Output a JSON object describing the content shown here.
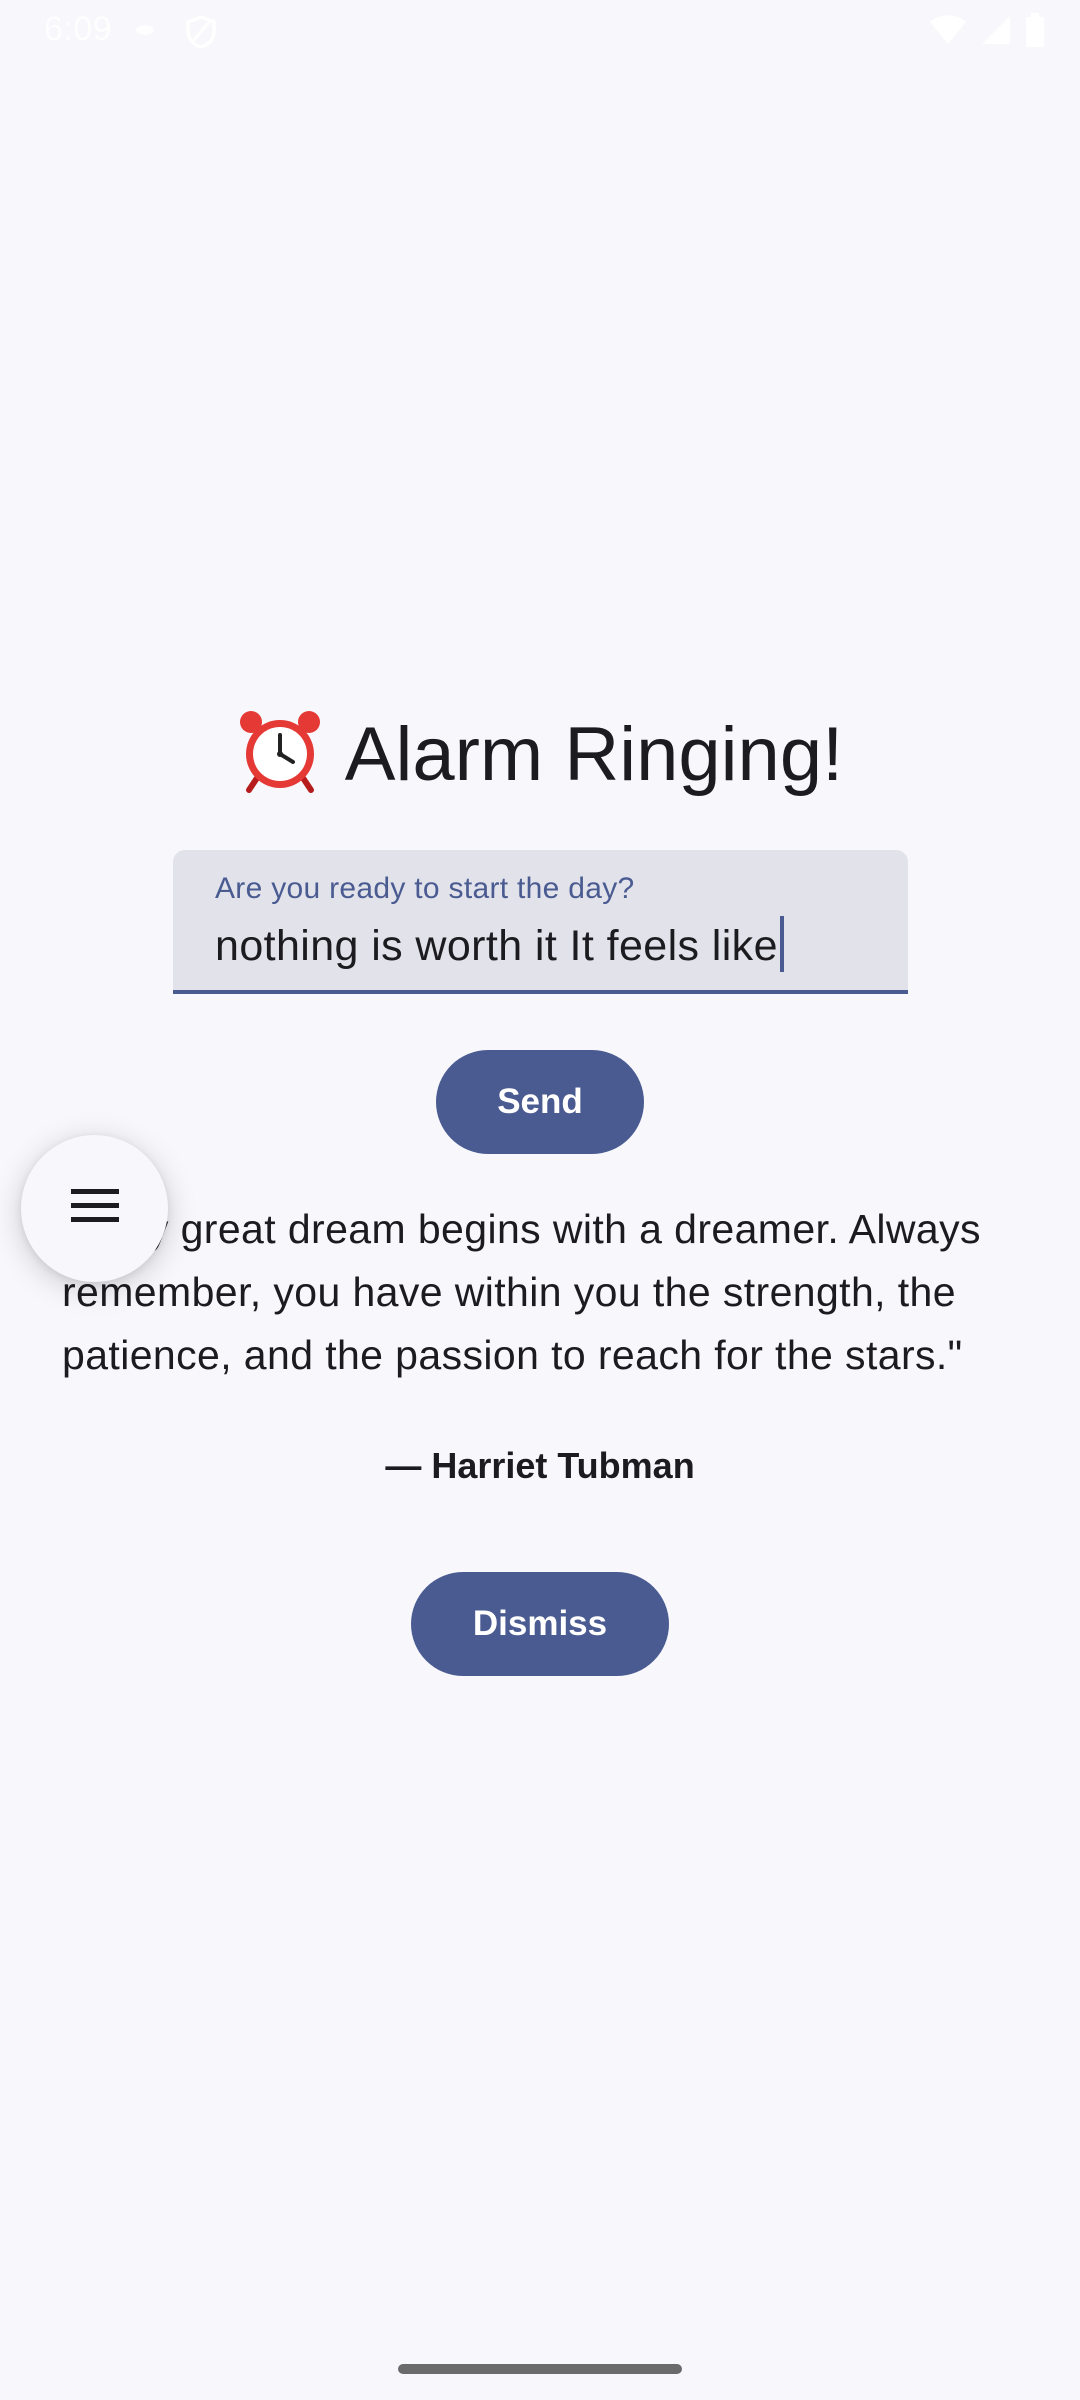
{
  "status_bar": {
    "time": "6:09",
    "icons": [
      "cloud-icon",
      "shield-icon",
      "wifi-icon",
      "signal-icon",
      "battery-icon"
    ]
  },
  "alarm": {
    "title": "Alarm Ringing!",
    "title_icon": "alarm-clock-icon"
  },
  "input": {
    "label": "Are you ready to start the day?",
    "value": "nothing is worth it It feels like"
  },
  "buttons": {
    "send_label": "Send",
    "dismiss_label": "Dismiss"
  },
  "quote": {
    "text": "Every great dream begins with a dreamer. Always remember, you have within you the strength, the patience, and the passion to reach for the stars.\"",
    "author": "— Harriet Tubman"
  },
  "fab": {
    "icon": "menu-icon"
  },
  "colors": {
    "background": "#f7f7fc",
    "primary": "#4a5b91",
    "field_background": "#e2e2ea",
    "text": "#1c1b1f"
  }
}
